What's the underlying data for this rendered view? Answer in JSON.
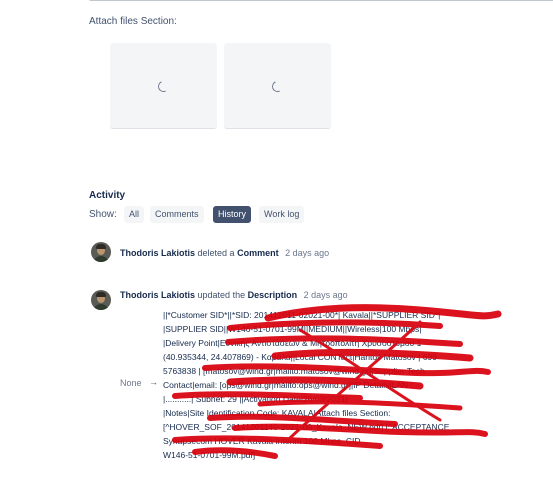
{
  "attachments": {
    "section_label": "Attach files Section:",
    "items": [
      {
        "state": "loading"
      },
      {
        "state": "loading"
      }
    ]
  },
  "activity": {
    "title": "Activity",
    "show_label": "Show:",
    "tabs": [
      {
        "label": "All",
        "active": false
      },
      {
        "label": "Comments",
        "active": false
      },
      {
        "label": "History",
        "active": true
      },
      {
        "label": "Work log",
        "active": false
      }
    ],
    "entries": [
      {
        "author": "Thodoris Lakiotis",
        "action": "deleted a",
        "object": "Comment",
        "time": "2 days ago"
      },
      {
        "author": "Thodoris Lakiotis",
        "action": "updated the",
        "object": "Description",
        "time": "2 days ago",
        "old_value": "None",
        "arrow": "→",
        "new_value_lines": [
          "||*Customer SID*||*SID: 201412011-02021-00*| Kavala||*SUPPLIER SID*|",
          "|SUPPLIER SID||W146-51-0701-99M||MEDIUM||Wireless|100 Mbps|",
          "|Delivery Point|Εθνικής Αντιστάσεων & Μητροπολίτη Χρυσοστόμου 1",
          "(40.935344, 24.407869) - Καβάλα||Local CONTact|Haritos Matosov | 699",
          "5763838 | [matosov@wind.gr|mailto:matosov@wind.gr]|Supplier Tech",
          "Contact|email: [ops@wind.gr|mailto:ops@wind.gr]|IP Details|LAN :",
          "|...........| Subnet: 29 ||Activation Date|26/03/2021|",
          "|Notes|Site Identification Code: KAVALA|Attach files Section:",
          "[^HOVER_SOF_20141201140-2021-00_Kavala_NEW.pdf] [^ACCEPTANCE",
          "Synapsecom HOVER Kavala Interim 100 Mbps_CID",
          "W146-51-0701-99M.pdf]"
        ]
      }
    ]
  },
  "colors": {
    "active_tab_bg": "#42526e",
    "tab_bg": "#f4f5f7",
    "redaction": "#d8000c"
  }
}
